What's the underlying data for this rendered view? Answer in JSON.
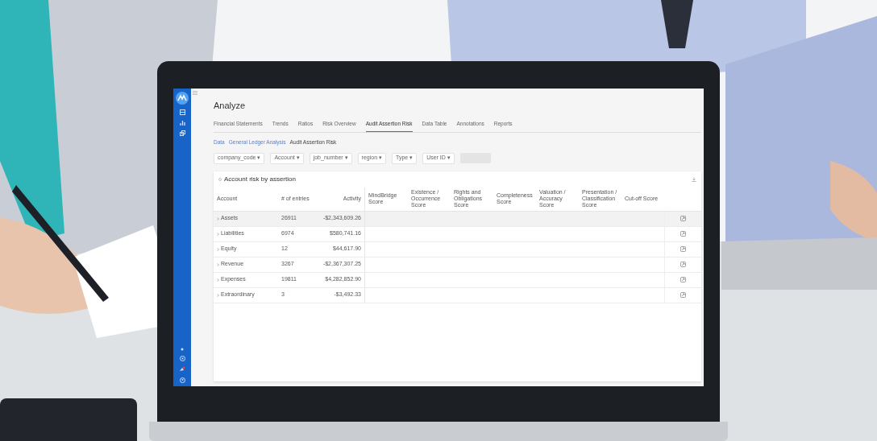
{
  "app": {
    "title": "Analyze",
    "tabs": [
      {
        "label": "Financial Statements",
        "selected": false
      },
      {
        "label": "Trends",
        "selected": false
      },
      {
        "label": "Ratios",
        "selected": false
      },
      {
        "label": "Risk Overview",
        "selected": false
      },
      {
        "label": "Audit Assertion Risk",
        "selected": true
      },
      {
        "label": "Data Table",
        "selected": false
      },
      {
        "label": "Annotations",
        "selected": false
      },
      {
        "label": "Reports",
        "selected": false
      }
    ],
    "breadcrumbs": [
      "Data",
      "General Ledger Analysis",
      "Audit Assertion Risk"
    ],
    "filters": [
      "company_code ▾",
      "Account ▾",
      "job_number ▾",
      "region ▾",
      "Type ▾",
      "User ID ▾"
    ],
    "reset_button": {
      "disabled": true
    },
    "card": {
      "title": "Account risk by assertion",
      "columns": [
        "Account",
        "# of entries",
        "Activity",
        "MindBridge Score",
        "Existence / Occurrence Score",
        "Rights and Obligations Score",
        "Completeness Score",
        "Valuation / Accuracy Score",
        "Presentation / Classification Score",
        "Cut-off Score"
      ],
      "rows": [
        {
          "account": "Assets",
          "entries": "26911",
          "activity": "-$2,343,609.26",
          "selected": true
        },
        {
          "account": "Liabilities",
          "entries": "6974",
          "activity": "$580,741.16",
          "selected": false
        },
        {
          "account": "Equity",
          "entries": "12",
          "activity": "$44,617.90",
          "selected": false
        },
        {
          "account": "Revenue",
          "entries": "3267",
          "activity": "-$2,367,307.25",
          "selected": false
        },
        {
          "account": "Expenses",
          "entries": "19811",
          "activity": "$4,282,852.90",
          "selected": false
        },
        {
          "account": "Extraordinary",
          "entries": "3",
          "activity": "-$3,492.33",
          "selected": false
        }
      ]
    }
  }
}
